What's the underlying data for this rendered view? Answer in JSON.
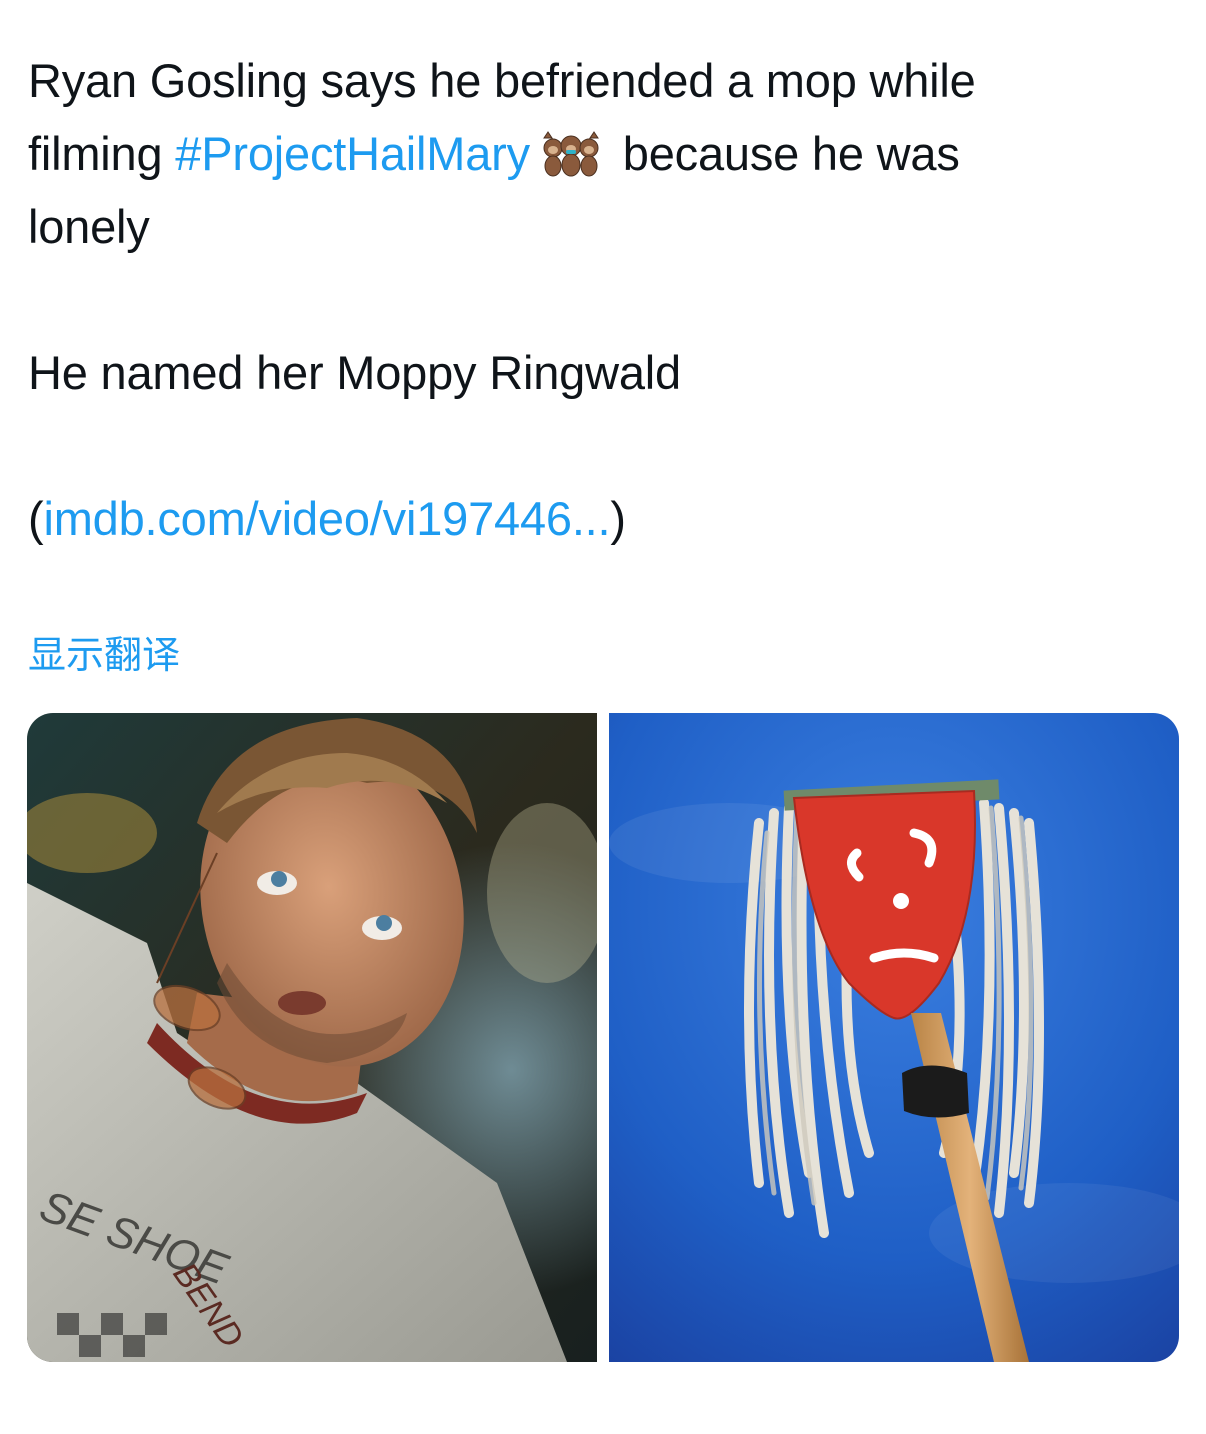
{
  "tweet": {
    "line1": "Ryan Gosling says he befriended a mop while",
    "line2_before": "filming ",
    "hashtag": "#ProjectHailMary",
    "line2_after": " because he was",
    "line3": "lonely",
    "line4": "He named her Moppy Ringwald",
    "link_open": "(",
    "link_text": "imdb.com/video/vi197446...",
    "link_close": ")",
    "emoji_icon": "three-monkeys-emoji"
  },
  "translate_label": "显示翻译",
  "media": {
    "left_shirt_text_1": "SE SHOE",
    "left_shirt_text_2": "BEND",
    "colors": {
      "link": "#1d9bf0",
      "mop_face": "#d9372a",
      "sky": "#1f5fc6"
    }
  }
}
